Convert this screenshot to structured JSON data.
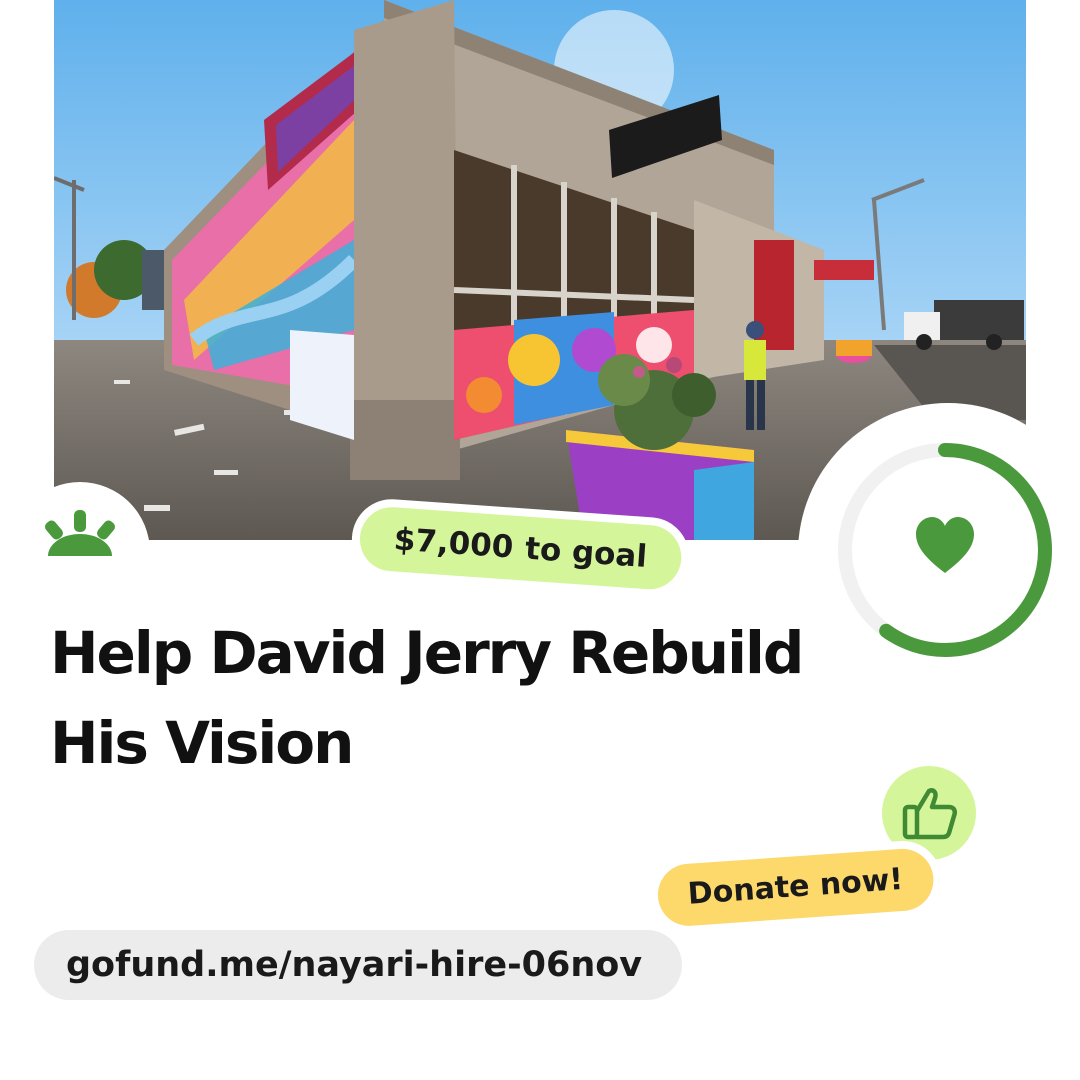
{
  "goal": {
    "amount": "$7,000",
    "suffix": "to goal"
  },
  "title": "Help David Jerry Rebuild His Vision",
  "progress": {
    "fraction": 0.6
  },
  "cta": {
    "label": "Donate now!"
  },
  "url": "gofund.me/nayari-hire-06nov",
  "colors": {
    "brand_green": "#4a9a3d",
    "goal_pill": "#d5f59b",
    "donate_pill": "#fdd86a",
    "url_pill": "#ececec",
    "ring_track": "#f1f1f1"
  },
  "icons": {
    "logo": "gofundme-sunrise-logo",
    "ring_center": "heart-icon",
    "badge": "thumbs-up-icon"
  }
}
